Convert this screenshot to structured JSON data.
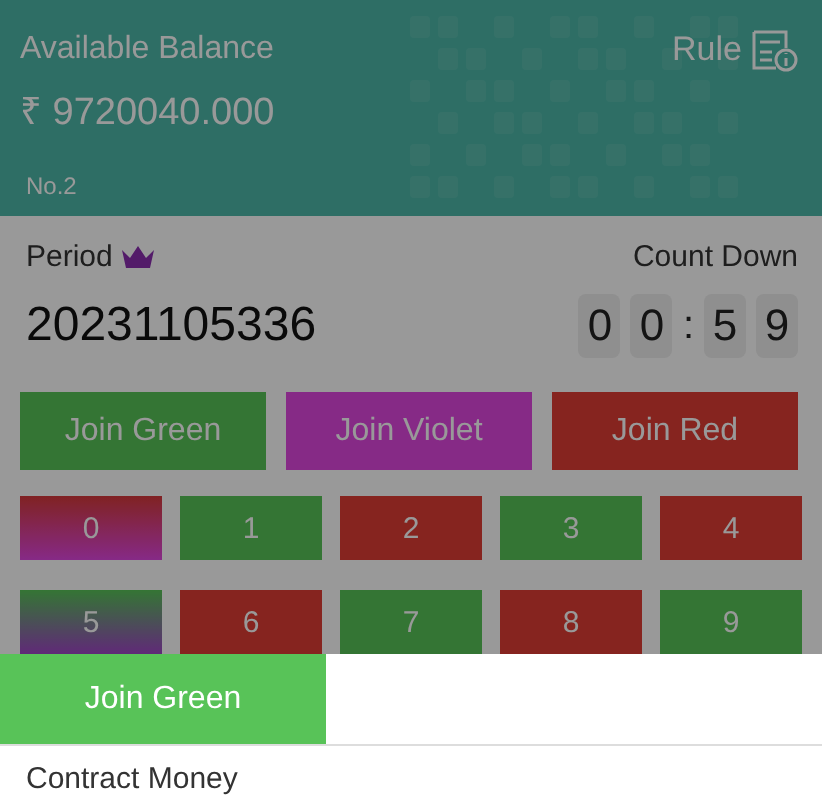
{
  "header": {
    "balance_label": "Available Balance",
    "balance": "₹ 9720040.000",
    "rule": "Rule",
    "rank": "No.2"
  },
  "period": {
    "label": "Period",
    "number": "20231105336"
  },
  "countdown": {
    "label": "Count Down",
    "minutes": [
      "0",
      "0"
    ],
    "separator": ":",
    "seconds": [
      "5",
      "9"
    ]
  },
  "join_buttons": [
    {
      "label": "Join Green",
      "kind": "green"
    },
    {
      "label": "Join Violet",
      "kind": "violet"
    },
    {
      "label": "Join Red",
      "kind": "red"
    }
  ],
  "numbers": [
    {
      "label": "0",
      "kind": "red_violet"
    },
    {
      "label": "1",
      "kind": "green"
    },
    {
      "label": "2",
      "kind": "red"
    },
    {
      "label": "3",
      "kind": "green"
    },
    {
      "label": "4",
      "kind": "red"
    },
    {
      "label": "5",
      "kind": "green_violet"
    },
    {
      "label": "6",
      "kind": "red"
    },
    {
      "label": "7",
      "kind": "green"
    },
    {
      "label": "8",
      "kind": "red"
    },
    {
      "label": "9",
      "kind": "green"
    }
  ],
  "sheet": {
    "title": "Join Green",
    "kind": "green",
    "field_label": "Contract Money"
  }
}
